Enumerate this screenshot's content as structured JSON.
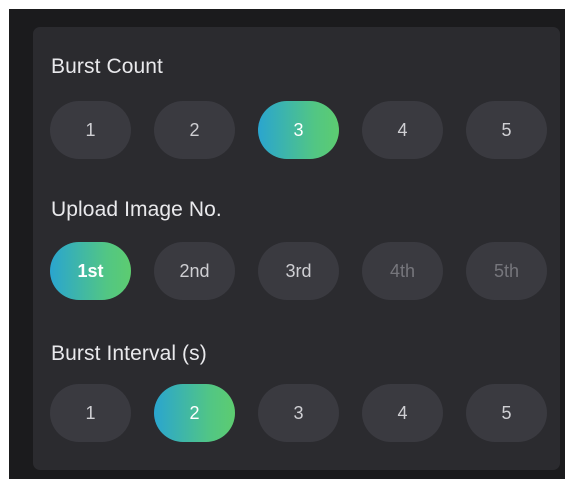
{
  "burst_count": {
    "label": "Burst Count",
    "options": [
      "1",
      "2",
      "3",
      "4",
      "5"
    ],
    "selected": "3"
  },
  "upload_image": {
    "label": "Upload Image No.",
    "options": [
      "1st",
      "2nd",
      "3rd",
      "4th",
      "5th"
    ],
    "selected": "1st",
    "disabled": [
      "4th",
      "5th"
    ]
  },
  "burst_interval": {
    "label": "Burst Interval (s)",
    "options": [
      "1",
      "2",
      "3",
      "4",
      "5"
    ],
    "selected": "2"
  },
  "colors": {
    "background": "#1b1b1d",
    "panel": "#2b2b2f",
    "pill": "#3a3a40",
    "selected_gradient_start": "#2aa5cf",
    "selected_gradient_end": "#5dcc70"
  }
}
